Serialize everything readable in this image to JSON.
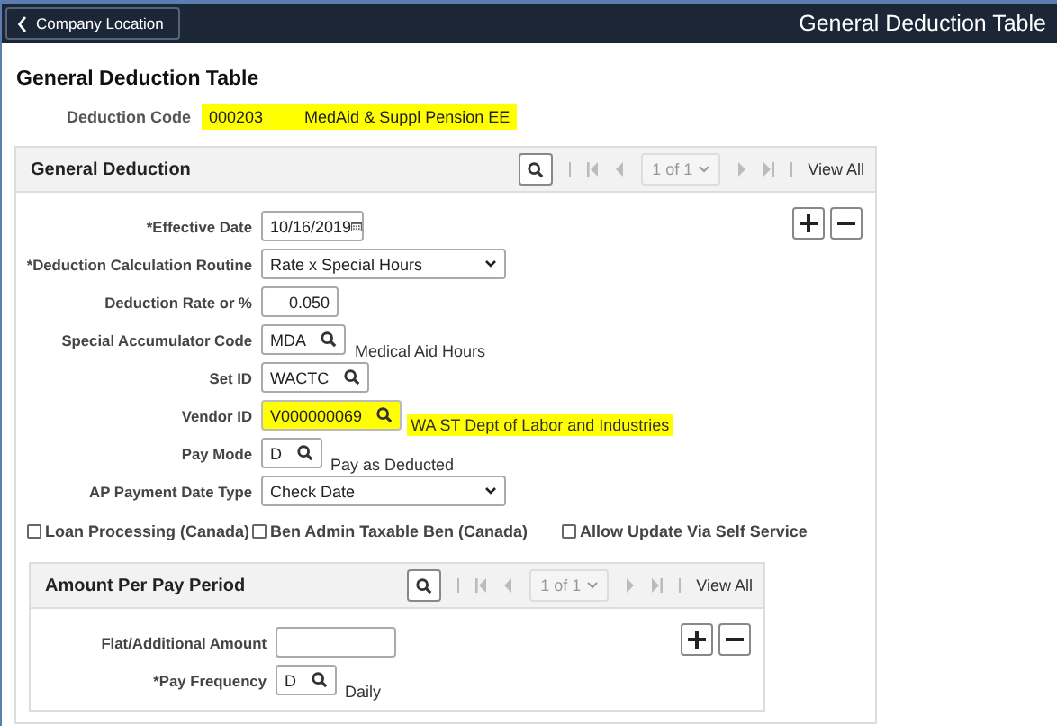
{
  "header": {
    "back_button": "Company Location",
    "title": "General Deduction Table"
  },
  "page_title": "General Deduction Table",
  "deduction_code": {
    "label": "Deduction Code",
    "code": "000203",
    "description": "MedAid & Suppl Pension EE",
    "highlighted": true
  },
  "panels": [
    {
      "title": "General Deduction",
      "pager": "1 of 1",
      "view_all": "View All",
      "fields": [
        {
          "kind": "date",
          "label": "*Effective Date",
          "value": "10/16/2019"
        },
        {
          "kind": "select",
          "label": "*Deduction Calculation Routine",
          "value": "Rate x Special Hours"
        },
        {
          "kind": "number",
          "label": "Deduction Rate or %",
          "value": "0.050"
        },
        {
          "kind": "lookup",
          "label": "Special Accumulator Code",
          "value": "MDA",
          "description": "Medical Aid Hours",
          "highlighted": false
        },
        {
          "kind": "lookup",
          "label": "Set ID",
          "value": "WACTC",
          "highlighted": false
        },
        {
          "kind": "lookup",
          "label": "Vendor ID",
          "value": "V000000069",
          "description": "WA ST Dept of Labor and Industries",
          "highlighted": true
        },
        {
          "kind": "lookup",
          "label": "Pay Mode",
          "value": "D",
          "description": "Pay as Deducted",
          "highlighted": false
        },
        {
          "kind": "select",
          "label": "AP Payment Date Type",
          "value": "Check Date"
        }
      ],
      "checkboxes": [
        {
          "label": "Loan Processing (Canada)",
          "checked": false
        },
        {
          "label": "Ben Admin Taxable Ben (Canada)",
          "checked": false
        },
        {
          "label": "Allow Update Via Self Service",
          "checked": false
        }
      ]
    },
    {
      "title": "Amount Per Pay Period",
      "pager": "1 of 1",
      "view_all": "View All",
      "fields": [
        {
          "kind": "text",
          "label": "Flat/Additional Amount"
        },
        {
          "kind": "lookup",
          "label": "*Pay Frequency",
          "value": "D",
          "description": "Daily",
          "highlighted": false
        }
      ]
    }
  ]
}
